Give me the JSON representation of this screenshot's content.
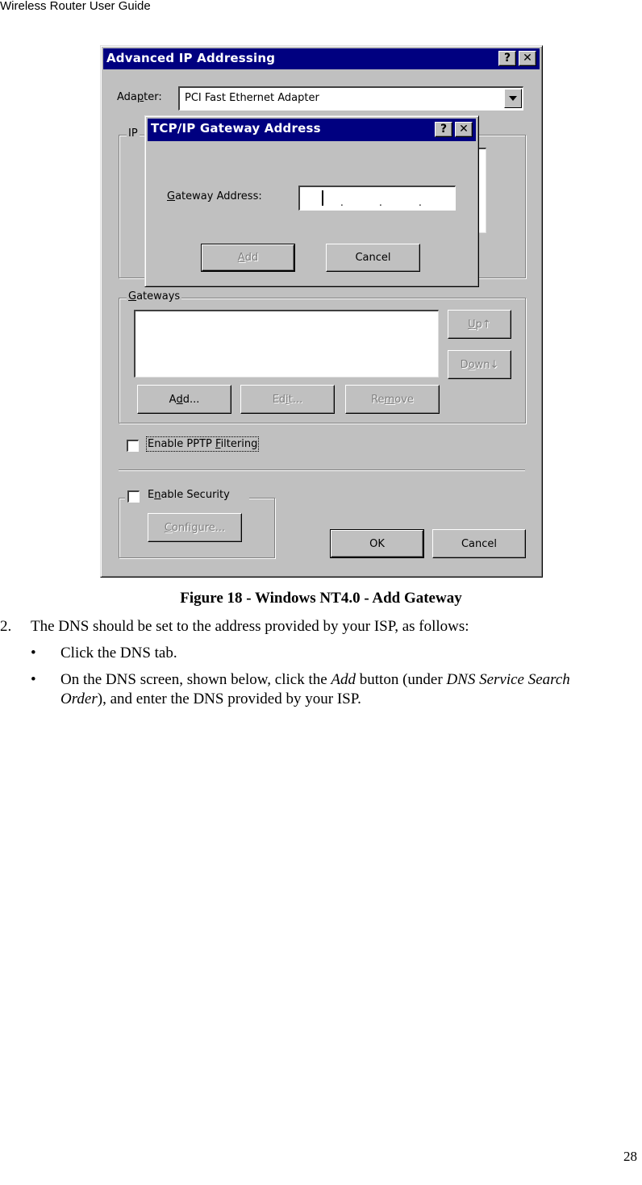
{
  "page": {
    "header": "Wireless Router User Guide",
    "page_number": "28"
  },
  "main_dialog": {
    "title": "Advanced IP Addressing",
    "help_button": "?",
    "close_button": "✕",
    "adapter_label": "Adapter:",
    "adapter_value": "PCI Fast Ethernet Adapter",
    "ip_group_caption": "IP",
    "gateways_caption": "Gateways",
    "up_button": "Up↑",
    "down_button": "Down↓",
    "add_button": "Add...",
    "edit_button": "Edit...",
    "remove_button": "Remove",
    "pptp_label": "Enable PPTP Filtering",
    "security_label": "Enable Security",
    "configure_button": "Configure...",
    "ok_button": "OK",
    "cancel_button": "Cancel"
  },
  "gateway_dialog": {
    "title": "TCP/IP Gateway Address",
    "help_button": "?",
    "close_button": "✕",
    "field_label": "Gateway Address:",
    "field_value": "",
    "add_button": "Add",
    "cancel_button": "Cancel"
  },
  "document": {
    "figure_caption": "Figure 18 - Windows NT4.0 - Add Gateway",
    "step_number": "2.",
    "step_text": "The DNS should be set to the address provided by your ISP, as follows:",
    "bullet_char": "•",
    "bullet1": "Click the DNS tab.",
    "bullet2_a": "On the DNS screen, shown below, click the ",
    "bullet2_add": "Add",
    "bullet2_b": " button (under ",
    "bullet2_dns": "DNS Service Search",
    "bullet2_order": "Order",
    "bullet2_c": "), and enter the DNS provided by your ISP."
  }
}
